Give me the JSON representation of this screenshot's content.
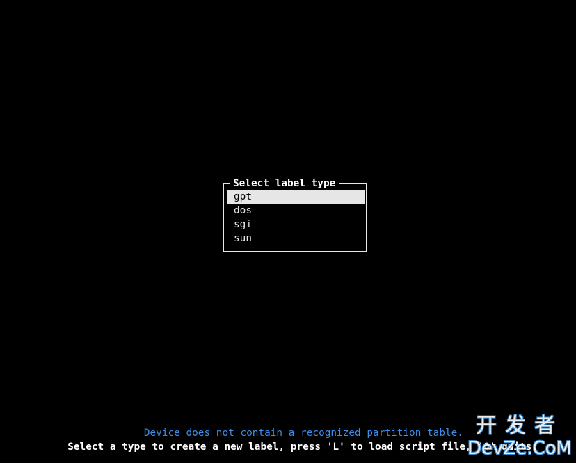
{
  "dialog": {
    "title": "Select label type",
    "items": [
      {
        "label": "gpt",
        "selected": true
      },
      {
        "label": "dos",
        "selected": false
      },
      {
        "label": "sgi",
        "selected": false
      },
      {
        "label": "sun",
        "selected": false
      }
    ]
  },
  "status": {
    "info": "Device does not contain a recognized partition table.",
    "hint": "Select a type to create a new label, press 'L' to load script file, 'Q' quits."
  },
  "watermark": {
    "cn": "开发者",
    "en": "DevZe.CoM"
  },
  "colors": {
    "background": "#000000",
    "foreground": "#e6e6e6",
    "info": "#3b8eea",
    "selection_bg": "#e6e6e6"
  }
}
